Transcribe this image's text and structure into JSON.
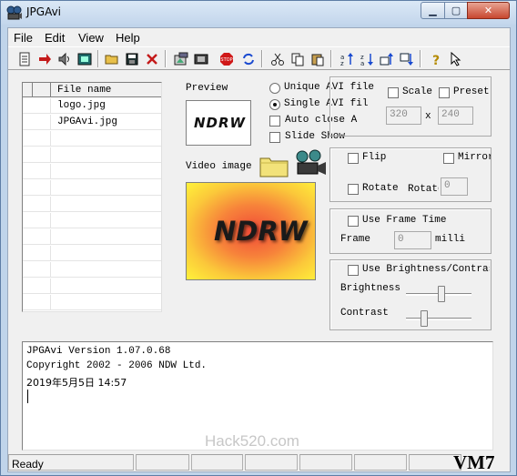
{
  "window": {
    "title": "JPGAvi",
    "minimize_glyph": "▁",
    "maximize_glyph": "▢",
    "close_glyph": "✕"
  },
  "menu": [
    "File",
    "Edit",
    "View",
    "Help"
  ],
  "toolbar": [
    "new-document-icon",
    "red-arrow-icon",
    "speaker-icon",
    "film-frame-icon",
    "open-folder-icon",
    "save-disk-icon",
    "delete-x-icon",
    "photo-import-icon",
    "film-strip-icon",
    "stop-sign-icon",
    "refresh-icon",
    "cut-icon",
    "copy-icon",
    "paste-icon",
    "sort-asc-icon",
    "sort-desc-icon",
    "move-up-icon",
    "move-down-icon",
    "help-question-icon",
    "pointer-icon"
  ],
  "filelist": {
    "header": "File name",
    "files": [
      "logo.jpg",
      "JPGAvi.jpg"
    ]
  },
  "preview": {
    "label": "Preview",
    "logo_text": "NDRW"
  },
  "video": {
    "label": "Video image",
    "logo_text": "NDRW"
  },
  "output_options": {
    "unique_avi": "Unique AVI file",
    "single_avi": "Single AVI fil",
    "auto_close": "Auto close A",
    "slide_show": "Slide Show",
    "selected": "single_avi"
  },
  "scale": {
    "scale_label": "Scale",
    "preset_label": "Preset",
    "width": "320",
    "x_label": "x",
    "height": "240"
  },
  "transform": {
    "flip": "Flip",
    "mirror": "Mirror",
    "rotate": "Rotate",
    "rotate_angle_label": "Rotate",
    "rotate_angle_value": "0"
  },
  "frame_time": {
    "use_label": "Use Frame Time",
    "frame_label": "Frame",
    "frame_value": "0",
    "unit": "milli"
  },
  "brightness": {
    "use_label": "Use Brightness/Contrast",
    "brightness_label": "Brightness",
    "contrast_label": "Contrast",
    "brightness_level": 0.55,
    "contrast_level": 0.25
  },
  "log": [
    "JPGAvi Version   1.07.0.68",
    "Copyright  2002 - 2006 NDW Ltd.",
    "2019年5月5日 14:57"
  ],
  "watermark": "Hack520.com",
  "status": {
    "text": "Ready"
  },
  "badge": "VM7"
}
